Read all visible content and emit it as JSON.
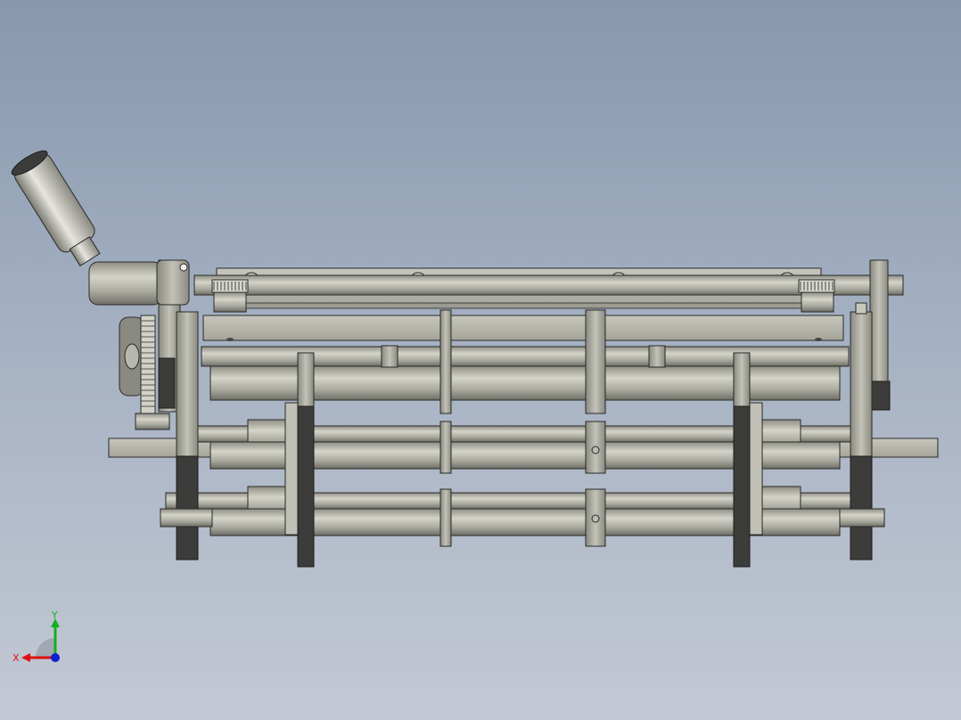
{
  "triad": {
    "x_label": "X",
    "y_label": "Y",
    "x_color": "#e01010",
    "y_color": "#10b020",
    "z_color": "#1020d0"
  },
  "model": {
    "metal_color": "#b9b9ae",
    "dark_color": "#3c3c3a",
    "edge_color": "#2a2a28",
    "handle_color": "#c8c8c0"
  }
}
